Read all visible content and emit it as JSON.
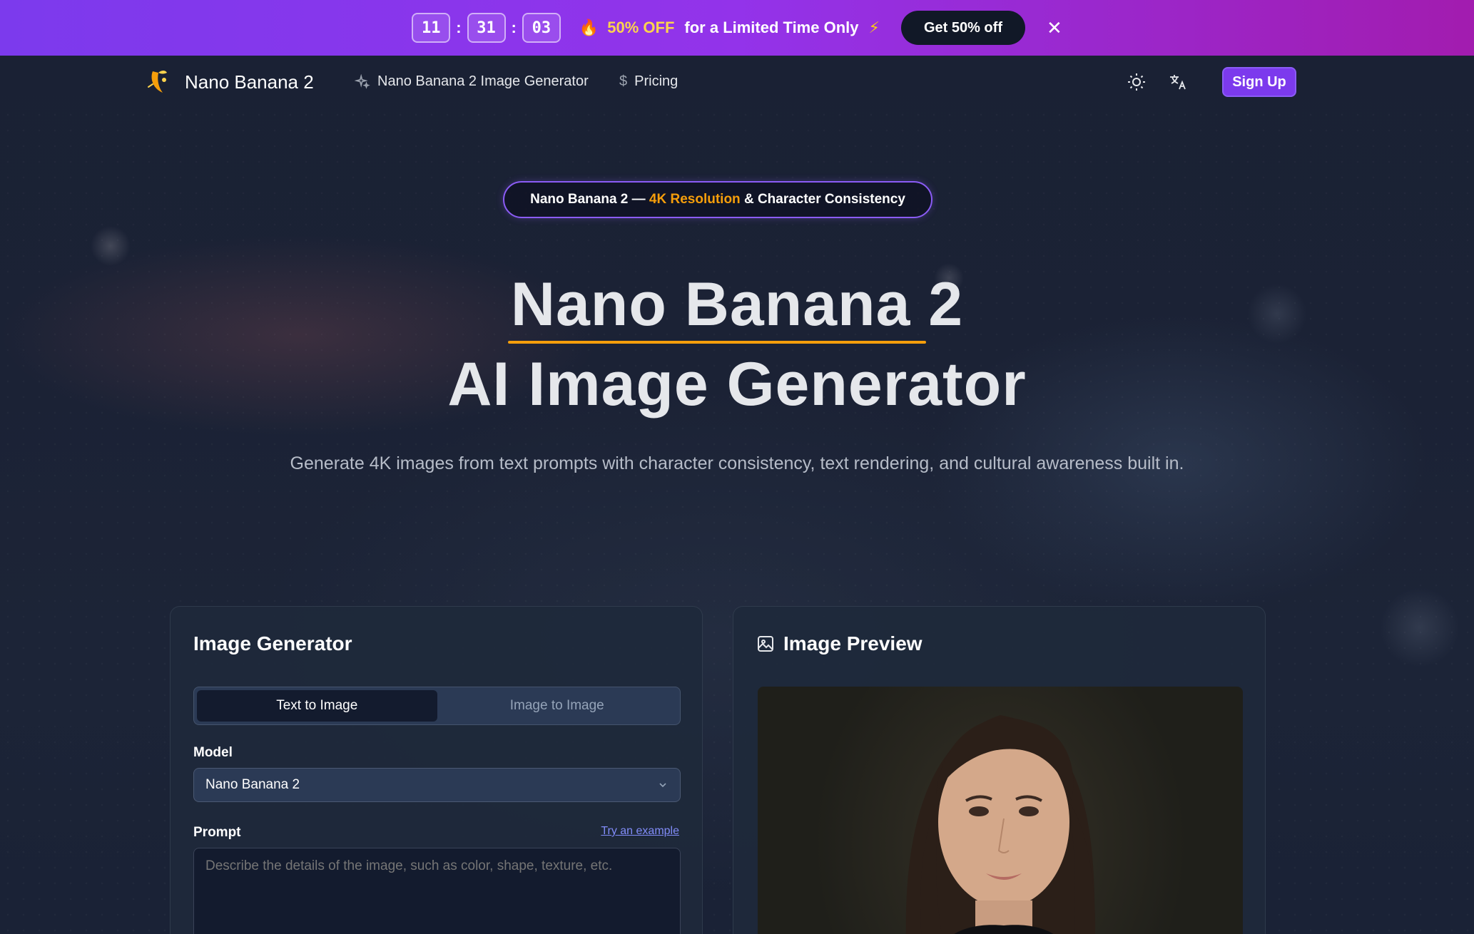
{
  "promo": {
    "timer": {
      "hours": "11",
      "minutes": "31",
      "seconds": "03"
    },
    "discount": "50% OFF",
    "text": "for a Limited Time Only",
    "button_label": "Get 50% off",
    "close_icon": "close-icon"
  },
  "nav": {
    "brand": "Nano Banana 2",
    "links": [
      {
        "label": "Nano Banana 2 Image Generator",
        "icon": "sparkles-icon"
      },
      {
        "label": "Pricing",
        "icon": "dollar-icon"
      }
    ],
    "theme_icon": "sun-icon",
    "language_icon": "translate-icon",
    "signup_label": "Sign Up"
  },
  "hero": {
    "badge_prefix": "Nano Banana 2 —",
    "badge_highlight": "4K Resolution",
    "badge_suffix": "& Character Consistency",
    "title_line1": "Nano Banana 2",
    "title_line2": "AI Image Generator",
    "subtitle": "Generate 4K images from text prompts with character consistency, text rendering, and cultural awareness built in."
  },
  "generator": {
    "title": "Image Generator",
    "tabs": [
      "Text to Image",
      "Image to Image"
    ],
    "active_tab": "Text to Image",
    "model_label": "Model",
    "model_value": "Nano Banana 2",
    "prompt_label": "Prompt",
    "try_example": "Try an example",
    "prompt_placeholder": "Describe the details of the image, such as color, shape, texture, etc."
  },
  "preview": {
    "title": "Image Preview",
    "icon": "image-icon"
  },
  "colors": {
    "accent": "#7c3aed",
    "highlight": "#f59e0b",
    "link": "#818cf8"
  }
}
